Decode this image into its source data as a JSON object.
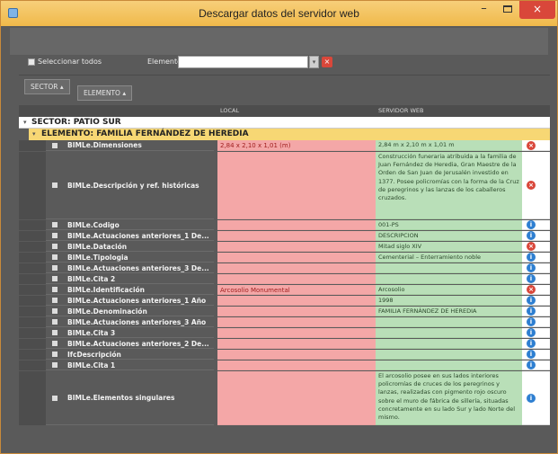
{
  "window": {
    "title": "Descargar datos del servidor web",
    "min_glyph": "–",
    "close_glyph": "×"
  },
  "filter": {
    "select_all_label": "Seleccionar todos",
    "element_label": "Elemento:",
    "element_value": "",
    "dropdown_glyph": "▾",
    "clear_glyph": "×"
  },
  "grouping": {
    "sector_chip": "SECTOR ▴",
    "elemento_chip": "ELEMENTO ▴"
  },
  "grid": {
    "columns": [
      "",
      "LOCAL",
      "SERVIDOR WEB"
    ],
    "sector_group": "SECTOR: PATIO SUR",
    "element_group": "ELEMENTO: FAMILIA FERNÁNDEZ DE HEREDIA",
    "collapse_glyph": "▾",
    "rows": [
      {
        "name": "BIMLe.Dimensiones",
        "local": "2,84 x 2,10 x 1,01 (m)",
        "web": "2,84 m x 2,10 m x 1,01 m",
        "status": "error"
      },
      {
        "name": "BIMLe.Descripción y ref. históricas",
        "local": "",
        "web": "Construcción funeraria atribuida a la familia de Juan Fernández de Heredia, Gran Maestre de la Orden de San Juan de Jerusalén investido en 1377. Posee policromías con la forma de la Cruz de peregrinos y las lanzas de los caballeros cruzados.",
        "status": "error"
      },
      {
        "name": "BIMLe.Codigo",
        "local": "",
        "web": "001-PS",
        "status": "info"
      },
      {
        "name": "BIMLe.Actuaciones anteriores_1 De...",
        "local": "",
        "web": "DESCRIPCION",
        "status": "info"
      },
      {
        "name": "BIMLe.Datación",
        "local": "",
        "web": "Mitad siglo XIV",
        "status": "error"
      },
      {
        "name": "BIMLe.Tipologia",
        "local": "",
        "web": "Cementerial – Enterramiento noble",
        "status": "info"
      },
      {
        "name": "BIMLe.Actuaciones anteriores_3 De...",
        "local": "",
        "web": "",
        "status": "info"
      },
      {
        "name": "BIMLe.Cita 2",
        "local": "",
        "web": "",
        "status": "info"
      },
      {
        "name": "BIMLe.Identificación",
        "local": "Arcosolio Monumental",
        "web": "Arcosolio",
        "status": "error"
      },
      {
        "name": "BIMLe.Actuaciones anteriores_1 Año",
        "local": "",
        "web": "1998",
        "status": "info"
      },
      {
        "name": "BIMLe.Denominación",
        "local": "",
        "web": "FAMILIA FERNÁNDEZ DE HEREDIA",
        "status": "info"
      },
      {
        "name": "BIMLe.Actuaciones anteriores_3 Año",
        "local": "",
        "web": "",
        "status": "info"
      },
      {
        "name": "BIMLe.Cita 3",
        "local": "",
        "web": "",
        "status": "info"
      },
      {
        "name": "BIMLe.Actuaciones anteriores_2 De...",
        "local": "",
        "web": "",
        "status": "info"
      },
      {
        "name": "IfcDescripción",
        "local": "",
        "web": "",
        "status": "info"
      },
      {
        "name": "BIMLe.Cita 1",
        "local": "",
        "web": "",
        "status": "info"
      },
      {
        "name": "BIMLe.Elementos singulares",
        "local": "",
        "web": "El arcosolio posee en sus lados interiores policromías de cruces de los peregrinos y lanzas, realizadas con pigmento rojo oscuro sobre el muro de fábrica de sillería, situadas concretamente en su lado Sur y lado Norte del mismo.",
        "status": "info"
      }
    ]
  },
  "status_glyphs": {
    "error": "×",
    "info": "i"
  },
  "colors": {
    "title_bar": "#f0b94a",
    "local_diff": "#f4a7a7",
    "web_value": "#b9dfb8",
    "error": "#d9473a",
    "info": "#2e7fd1",
    "element_group": "#f7d774"
  }
}
